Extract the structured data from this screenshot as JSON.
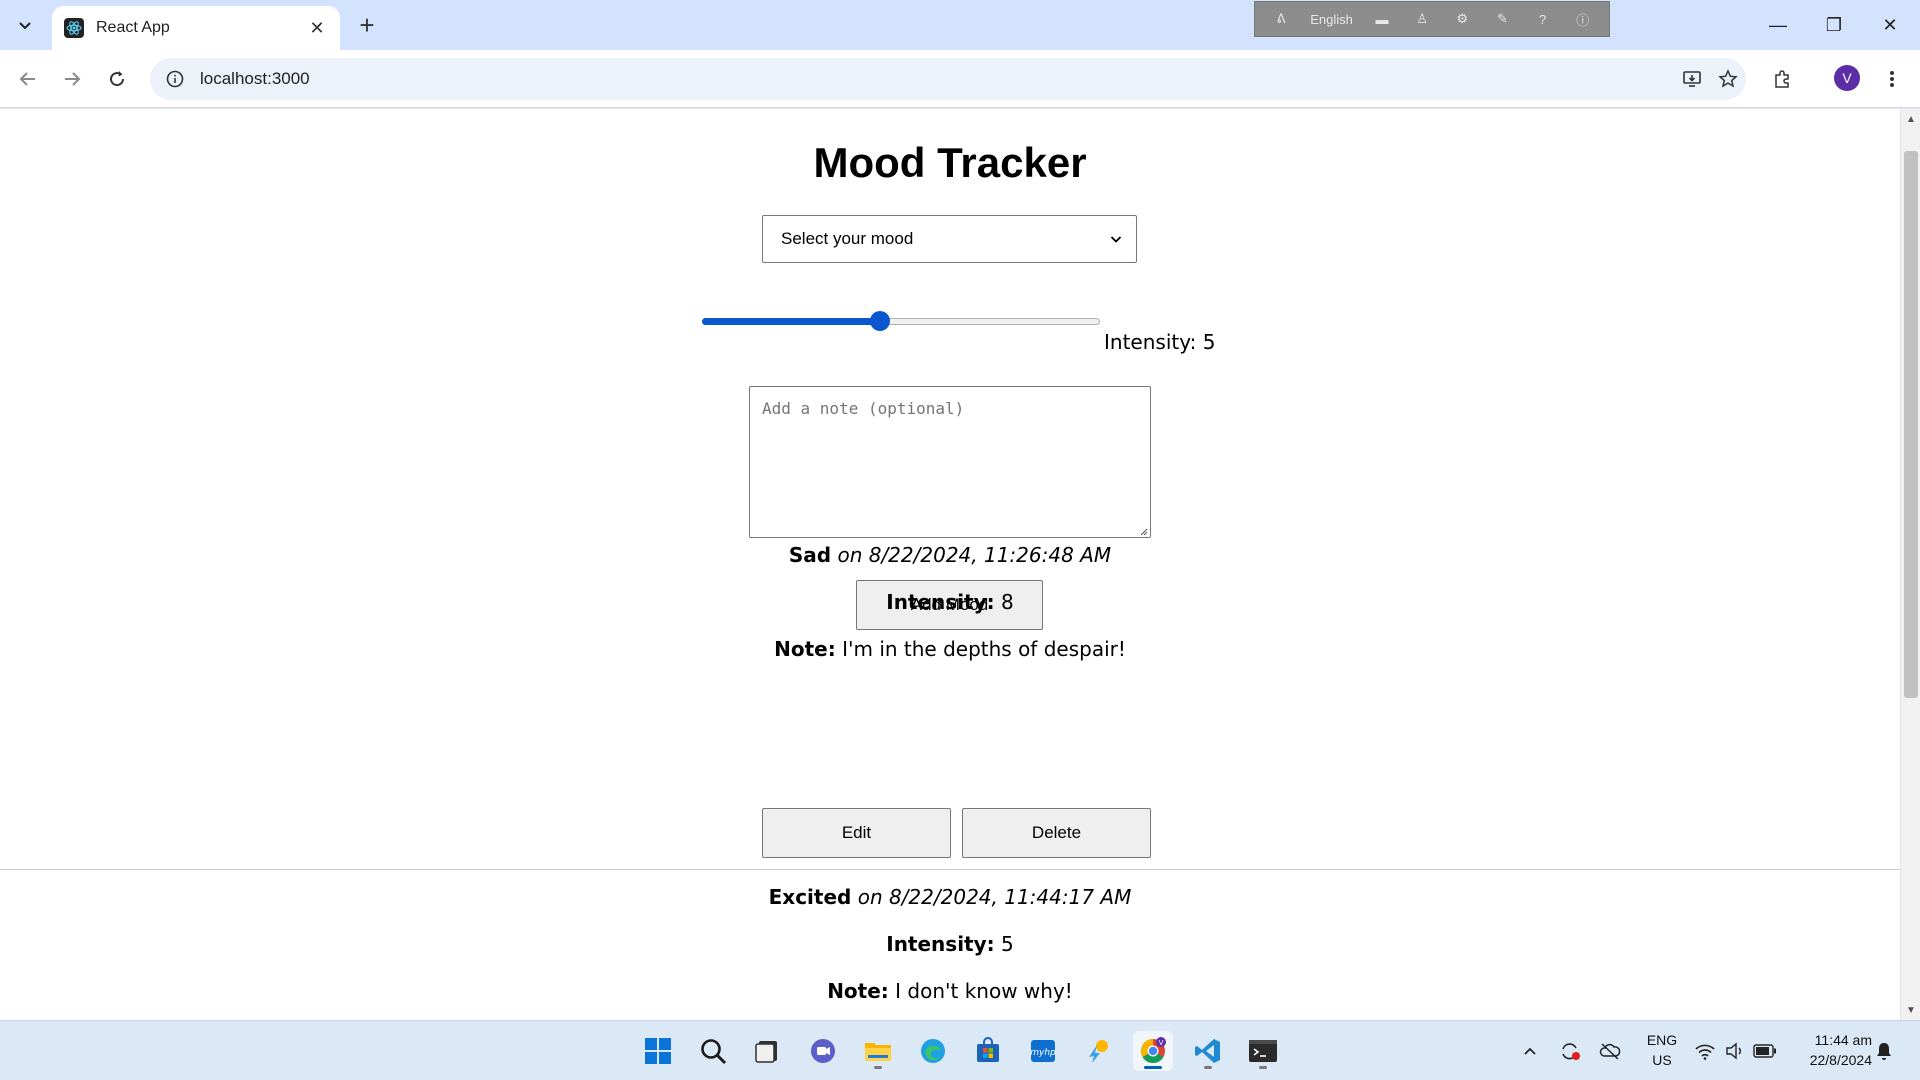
{
  "browser": {
    "tab_title": "React App",
    "url": "localhost:3000",
    "profile_initial": "V",
    "ime_language": "English"
  },
  "page": {
    "title": "Mood Tracker",
    "mood_select": {
      "selected": "Select your mood"
    },
    "intensity": {
      "label": "Intensity: 5",
      "value": 5,
      "min": 1,
      "max": 10
    },
    "note": {
      "placeholder": "Add a note (optional)"
    },
    "add_button": "Add Mood",
    "entries": [
      {
        "mood": "Sad",
        "timestamp": "on 8/22/2024, 11:26:48 AM",
        "intensity_label": "Intensity:",
        "intensity_value": "8",
        "note_label": "Note:",
        "note_text": "I'm in the depths of despair!",
        "edit_label": "Edit",
        "delete_label": "Delete"
      },
      {
        "mood": "Excited",
        "timestamp": "on 8/22/2024, 11:44:17 AM",
        "intensity_label": "Intensity:",
        "intensity_value": "5",
        "note_label": "Note:",
        "note_text": "I don't know why!"
      }
    ]
  },
  "taskbar": {
    "apps": [
      "start-icon",
      "search-icon",
      "task-view-icon",
      "meet-icon",
      "file-explorer-icon",
      "edge-icon",
      "store-icon",
      "myhp-icon",
      "weather-icon",
      "chrome-icon",
      "vscode-icon",
      "terminal-icon"
    ],
    "language": "ENG",
    "region": "US",
    "time": "11:44 am",
    "date": "22/8/2024"
  },
  "colors": {
    "accent": "#0b57d0",
    "tabbar": "#d3e3fd",
    "taskbar": "#dbe8f5"
  }
}
